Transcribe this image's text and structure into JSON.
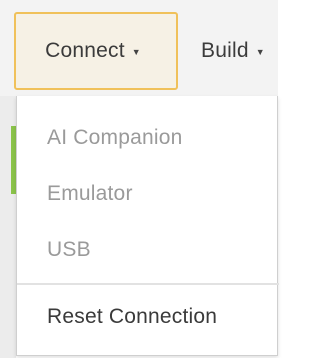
{
  "menubar": {
    "connect_label": "Connect",
    "build_label": "Build"
  },
  "connect_menu": {
    "items": [
      {
        "label": "AI Companion",
        "state": "disabled"
      },
      {
        "label": "Emulator",
        "state": "disabled"
      },
      {
        "label": "USB",
        "state": "disabled"
      },
      {
        "label": "Reset Connection",
        "state": "enabled"
      }
    ]
  },
  "colors": {
    "active_tab_border": "#f0c15a",
    "active_tab_bg": "#f6f1e5",
    "disabled_text": "#9a9a9a",
    "enabled_text": "#3a3a3a",
    "accent_green": "#8bc34a"
  },
  "icons": {
    "caret": "caret-down-icon"
  }
}
